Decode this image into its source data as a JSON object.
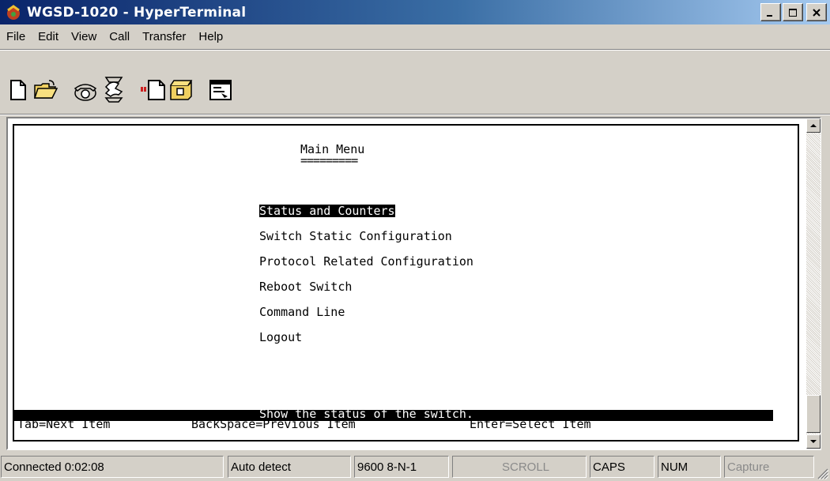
{
  "window": {
    "title": "WGSD-1020 - HyperTerminal",
    "buttons": {
      "minimize": "_",
      "maximize": "□",
      "close": "×"
    }
  },
  "menu": [
    "File",
    "Edit",
    "View",
    "Call",
    "Transfer",
    "Help"
  ],
  "toolbar": {
    "icons": [
      "new-document-icon",
      "open-folder-icon",
      "dial-phone-icon",
      "disconnect-phone-icon",
      "send-file-icon",
      "receive-file-icon",
      "properties-icon"
    ]
  },
  "terminal": {
    "menu_title": "Main Menu",
    "menu_underline": "=========",
    "selected_item": "Status and Counters",
    "items": [
      "Switch Static Configuration",
      "Protocol Related Configuration",
      "Reboot Switch",
      "Command Line",
      "Logout"
    ],
    "help_message": "Show the status of the switch.",
    "key_hint_tab": "Tab=Next Item",
    "key_hint_backspace": "BackSpace=Previous Item",
    "key_hint_enter": "Enter=Select Item"
  },
  "statusbar": {
    "connected": "Connected 0:02:08",
    "detect": "Auto detect",
    "settings": "9600 8-N-1",
    "scroll": "SCROLL",
    "caps": "CAPS",
    "num": "NUM",
    "capture": "Capture"
  },
  "colors": {
    "titlebar_start": "#0a246a",
    "titlebar_end": "#a6caf0",
    "window_face": "#d4d0c8",
    "highlight": "#000000"
  }
}
